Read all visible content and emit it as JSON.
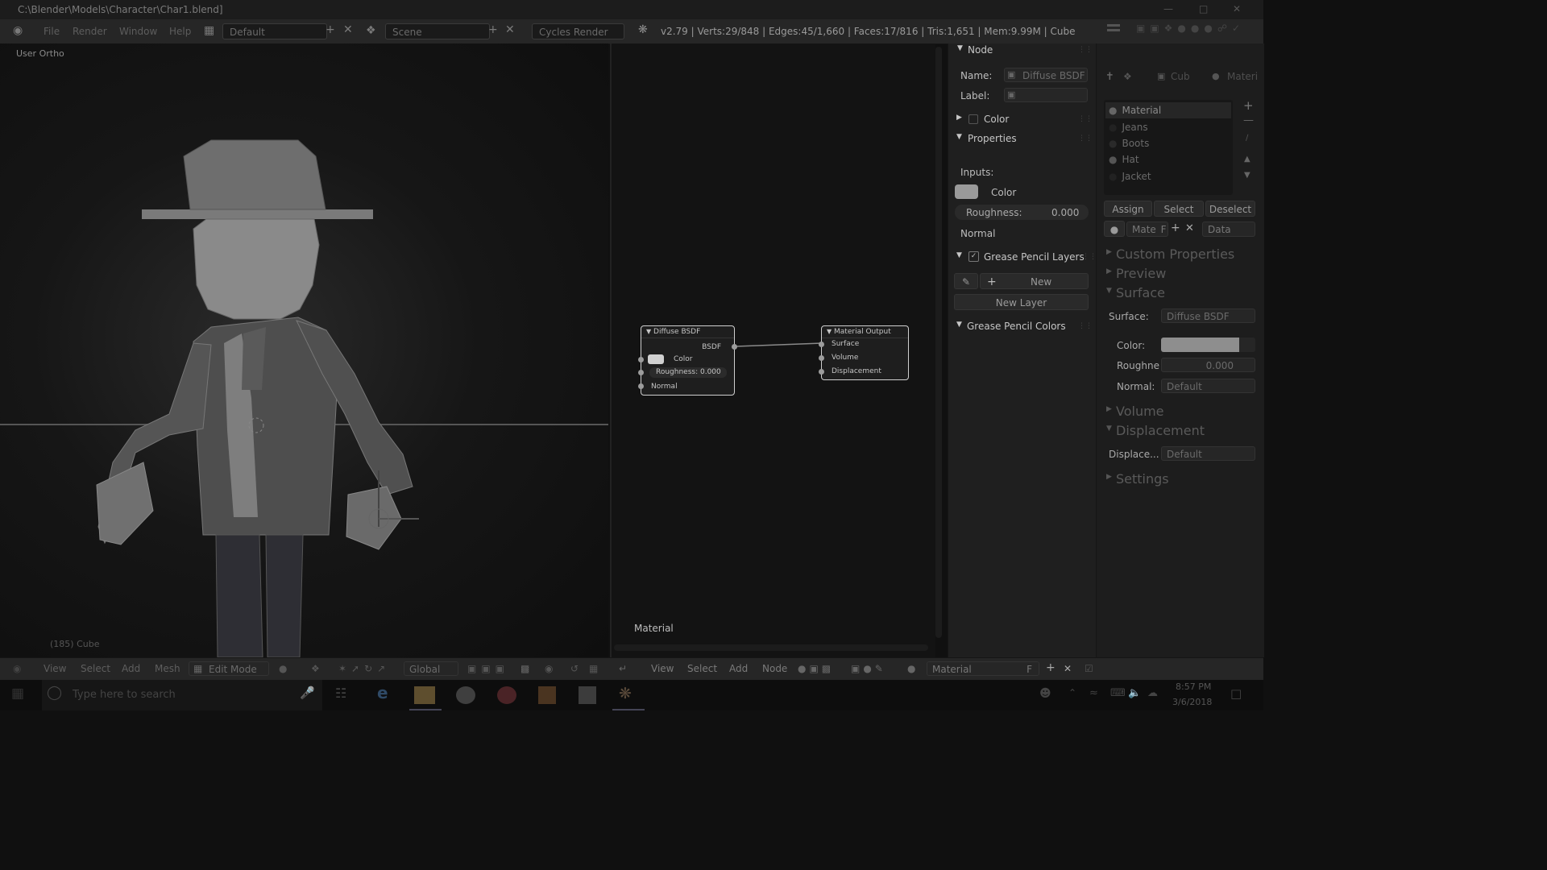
{
  "window": {
    "title": "C:\\Blender\\Models\\Character\\Char1.blend]"
  },
  "topbar": {
    "menus": [
      "File",
      "Render",
      "Window",
      "Help"
    ],
    "layout": "Default",
    "scene": "Scene",
    "engine": "Cycles Render",
    "info": "v2.79 | Verts:29/848 | Edges:45/1,660 | Faces:17/816 | Tris:1,651 | Mem:9.99M | Cube"
  },
  "viewport": {
    "label": "User Ortho",
    "object": "(185) Cube"
  },
  "node_editor": {
    "diffuse": {
      "title": "Diffuse BSDF",
      "output": "BSDF",
      "color": "Color",
      "roughness": "Roughness: 0.000",
      "normal": "Normal"
    },
    "output": {
      "title": "Material Output",
      "surface": "Surface",
      "volume": "Volume",
      "displacement": "Displacement"
    },
    "material_label": "Material"
  },
  "sidebar": {
    "node_title": "Node",
    "name_label": "Name:",
    "name_value": "Diffuse BSDF",
    "label_label": "Label:",
    "color_panel": "Color",
    "properties_panel": "Properties",
    "inputs_label": "Inputs:",
    "input_color": "Color",
    "roughness_label": "Roughness:",
    "roughness_value": "0.000",
    "normal": "Normal",
    "gp_layers": "Grease Pencil Layers",
    "new_btn": "New",
    "new_layer_btn": "New Layer",
    "gp_colors": "Grease Pencil Colors"
  },
  "properties": {
    "breadcrumb_obj": "Cub",
    "breadcrumb_mat": "Materi",
    "slots": [
      "Material",
      "Jeans",
      "Boots",
      "Hat",
      "Jacket"
    ],
    "assign": "Assign",
    "select": "Select",
    "deselect": "Deselect",
    "mat_name": "Mate",
    "mat_f": "F",
    "data": "Data",
    "custom_props": "Custom Properties",
    "preview": "Preview",
    "surface": "Surface",
    "surface_label": "Surface:",
    "surface_value": "Diffuse BSDF",
    "color_label": "Color:",
    "roughness_label": "Roughne",
    "roughness_value": "0.000",
    "normal_label": "Normal:",
    "normal_value": "Default",
    "volume": "Volume",
    "displacement": "Displacement",
    "displace_label": "Displace...",
    "displace_value": "Default",
    "settings": "Settings"
  },
  "bottombar": {
    "view": "View",
    "select": "Select",
    "add": "Add",
    "mesh": "Mesh",
    "mode": "Edit Mode",
    "orientation": "Global",
    "node_view": "View",
    "node_select": "Select",
    "node_add": "Add",
    "node": "Node",
    "material": "Material",
    "f": "F"
  },
  "taskbar": {
    "search_placeholder": "Type here to search",
    "time": "8:57 PM",
    "date": "3/6/2018"
  }
}
